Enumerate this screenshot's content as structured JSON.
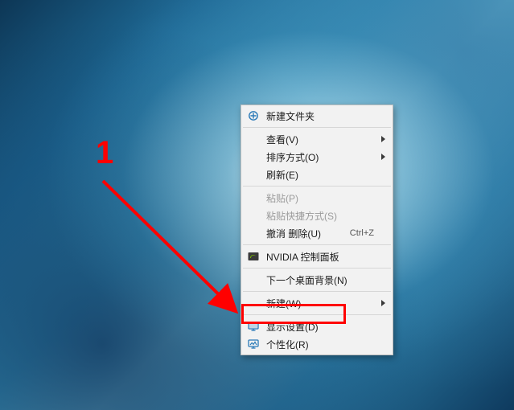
{
  "annotation": {
    "number": "1"
  },
  "menu": {
    "new_folder": "新建文件夹",
    "view": "查看(V)",
    "sort": "排序方式(O)",
    "refresh": "刷新(E)",
    "paste": "粘贴(P)",
    "paste_shortcut": "粘贴快捷方式(S)",
    "undo_delete": "撤消 删除(U)",
    "undo_delete_key": "Ctrl+Z",
    "nvidia": "NVIDIA 控制面板",
    "next_bg": "下一个桌面背景(N)",
    "new": "新建(W)",
    "display_settings": "显示设置(D)",
    "personalize": "个性化(R)"
  }
}
